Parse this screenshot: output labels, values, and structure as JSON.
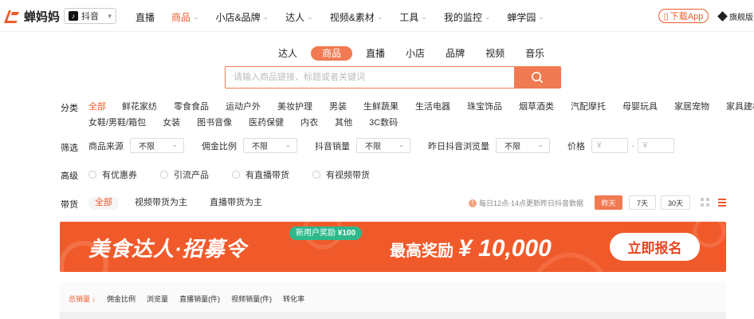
{
  "brand": {
    "name": "蝉妈妈",
    "accent": "#f05a2b"
  },
  "platform": {
    "selected": "抖音",
    "icon": "tiktok-icon"
  },
  "nav": [
    {
      "label": "直播",
      "active": false
    },
    {
      "label": "商品",
      "active": true
    },
    {
      "label": "小店&品牌",
      "active": false
    },
    {
      "label": "达人",
      "active": false
    },
    {
      "label": "视频&素材",
      "active": false
    },
    {
      "label": "工具",
      "active": false
    },
    {
      "label": "我的监控",
      "active": false
    },
    {
      "label": "蝉学园",
      "active": false
    }
  ],
  "header_actions": {
    "download": "下载App",
    "flagship": "旗舰版"
  },
  "search": {
    "tabs": [
      "达人",
      "商品",
      "直播",
      "小店",
      "品牌",
      "视频",
      "音乐"
    ],
    "active_tab": "商品",
    "placeholder": "请输入商品链接、标题或者关键词"
  },
  "filters": {
    "category_label": "分类",
    "categories_row1": [
      "全部",
      "鲜花家纺",
      "零食食品",
      "运动户外",
      "美妆护理",
      "男装",
      "生鲜蔬果",
      "生活电器",
      "珠宝饰品",
      "烟草酒类",
      "汽配摩托",
      "母婴玩具",
      "家居宠物",
      "家具建材"
    ],
    "categories_row2": [
      "女鞋/男鞋/箱包",
      "女装",
      "图书音像",
      "医药保健",
      "内衣",
      "其他",
      "3C数码"
    ],
    "screen_label": "筛选",
    "selects": [
      {
        "label": "商品来源",
        "value": "不限"
      },
      {
        "label": "佣金比例",
        "value": "不限"
      },
      {
        "label": "抖音销量",
        "value": "不限"
      },
      {
        "label": "昨日抖音浏览量",
        "value": "不限"
      }
    ],
    "price": {
      "label": "价格",
      "min_placeholder": "¥",
      "max_placeholder": "¥",
      "separator": "-"
    },
    "advanced_label": "高级",
    "checkboxes": [
      "有优惠券",
      "引流产品",
      "有直播带货",
      "有视频带货"
    ],
    "goods_label": "带货",
    "goods_tabs": [
      "全部",
      "视频带货为主",
      "直播带货为主"
    ],
    "notice": "每日12点-14点更新昨日抖音数据",
    "periods": [
      "昨天",
      "7天",
      "30天"
    ],
    "active_period": "昨天"
  },
  "banner": {
    "title": "美食达人·招募令",
    "badge_text": "新用户奖励",
    "badge_amount": "¥100",
    "reward_label": "最高奖励",
    "reward_amount": "¥ 10,000",
    "cta": "立即报名"
  },
  "sort_options": [
    "总销量",
    "佣金比例",
    "浏览量",
    "直播销量(件)",
    "视频销量(件)",
    "转化率"
  ],
  "active_sort": "总销量"
}
